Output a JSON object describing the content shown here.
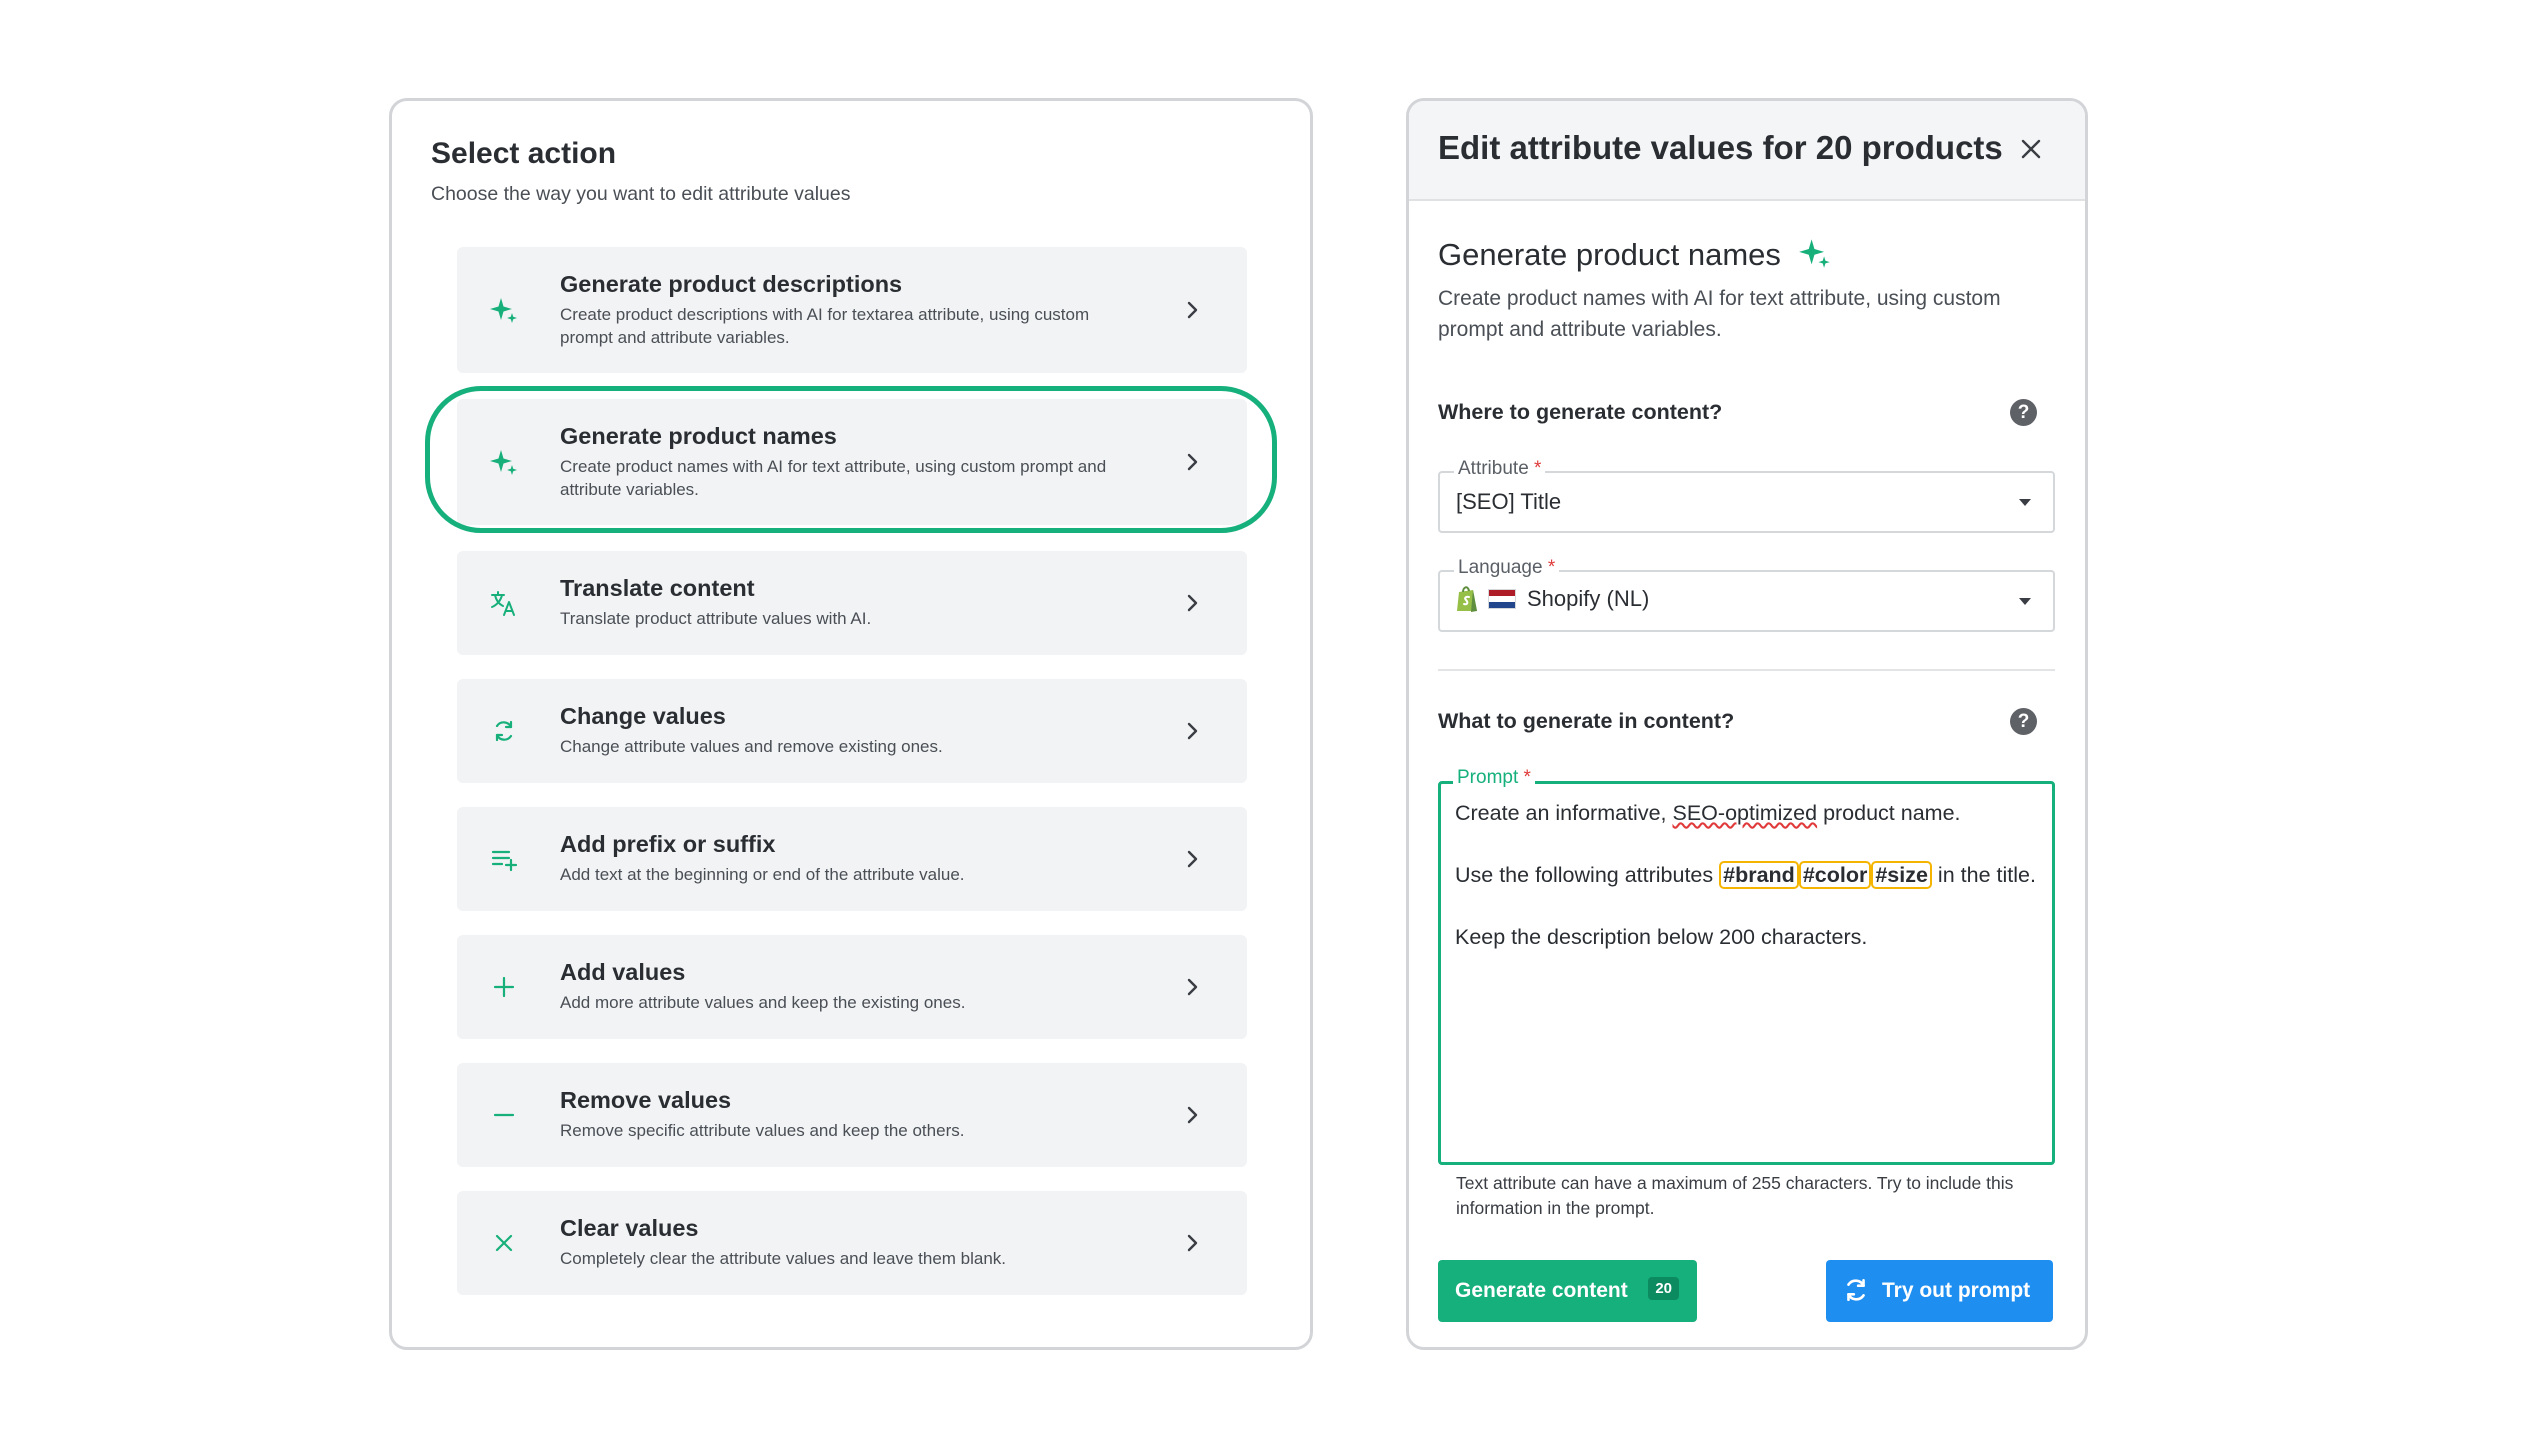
{
  "select_action": {
    "title": "Select action",
    "subtitle": "Choose the way you want to edit attribute values",
    "actions": [
      {
        "icon": "sparkle-icon",
        "title": "Generate product descriptions",
        "desc": "Create product descriptions with AI for textarea attribute, using custom prompt and attribute variables."
      },
      {
        "icon": "sparkle-icon",
        "title": "Generate product names",
        "desc": "Create product names with AI for text attribute, using custom prompt and attribute variables."
      },
      {
        "icon": "translate-icon",
        "title": "Translate content",
        "desc": "Translate product attribute values with AI."
      },
      {
        "icon": "refresh-icon",
        "title": "Change values",
        "desc": "Change attribute values and remove existing ones."
      },
      {
        "icon": "text-add-icon",
        "title": "Add prefix or suffix",
        "desc": "Add text at the beginning or end of the attribute value."
      },
      {
        "icon": "plus-icon",
        "title": "Add values",
        "desc": "Add more attribute values and keep the existing ones."
      },
      {
        "icon": "minus-icon",
        "title": "Remove values",
        "desc": "Remove specific attribute values and keep the others."
      },
      {
        "icon": "close-icon",
        "title": "Clear values",
        "desc": "Completely clear the attribute values and leave them blank."
      }
    ],
    "highlighted_index": 1
  },
  "edit_panel": {
    "header_title": "Edit attribute values for 20 products",
    "section_title": "Generate product names",
    "section_desc": "Create product names with AI for text attribute, using custom prompt and attribute variables.",
    "where_title": "Where to generate content?",
    "attribute_label": "Attribute",
    "attribute_value": "[SEO] Title",
    "language_label": "Language",
    "language_value": "Shopify (NL)",
    "what_title": "What to generate in content?",
    "prompt_label": "Prompt",
    "prompt_line1_a": "Create an informative, ",
    "prompt_line1_b": "SEO-optimized",
    "prompt_line1_c": " product name.",
    "prompt_line2_a": "Use the following attributes ",
    "tags": [
      "#brand",
      "#color",
      "#size"
    ],
    "prompt_line2_b": " in the title.",
    "prompt_line3": "Keep the description below 200 characters.",
    "required_mark": "*",
    "hint": "Text attribute can have a maximum of 255 characters. Try to include this information in the prompt.",
    "generate_label": "Generate content",
    "generate_count": "20",
    "try_label": "Try out prompt",
    "accent_color": "#16b07c",
    "button_blue": "#1f8ef1"
  }
}
